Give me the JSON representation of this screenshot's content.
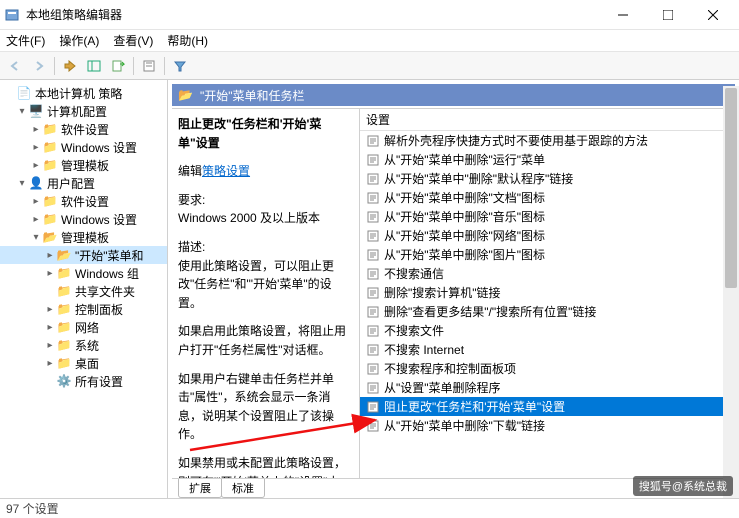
{
  "window": {
    "title": "本地组策略编辑器"
  },
  "menu": {
    "file": "文件(F)",
    "action": "操作(A)",
    "view": "查看(V)",
    "help": "帮助(H)"
  },
  "tree": {
    "root": "本地计算机 策略",
    "computer": "计算机配置",
    "c_soft": "软件设置",
    "c_win": "Windows 设置",
    "c_adm": "管理模板",
    "user": "用户配置",
    "u_soft": "软件设置",
    "u_win": "Windows 设置",
    "u_adm": "管理模板",
    "start": "\"开始\"菜单和",
    "wincomp": "Windows 组",
    "shared": "共享文件夹",
    "cpanel": "控制面板",
    "network": "网络",
    "system": "系统",
    "desktop": "桌面",
    "allset": "所有设置"
  },
  "category": {
    "header": "\"开始\"菜单和任务栏"
  },
  "detail": {
    "setting_title": "阻止更改\"任务栏和'开始'菜单\"设置",
    "edit_link": "策略设置",
    "req_label": "要求:",
    "req_text": "Windows 2000 及以上版本",
    "desc_label": "描述:",
    "desc1": "使用此策略设置，可以阻止更改\"任务栏\"和\"'开始'菜单\"的设置。",
    "desc2": "如果启用此策略设置，将阻止用户打开\"任务栏属性\"对话框。",
    "desc3": "如果用户右键单击任务栏并单击\"属性\"，系统会显示一条消息，说明某个设置阻止了该操作。",
    "desc4": "如果禁用或未配置此策略设置，则可在\"'开始'菜单上的\"设置\"中显示\"任务栏\"和\"'开始'菜单项。"
  },
  "list": {
    "header": "设置",
    "items": [
      "解析外壳程序快捷方式时不要使用基于跟踪的方法",
      "从\"开始\"菜单中删除\"运行\"菜单",
      "从\"开始\"菜单中\"删除\"默认程序\"链接",
      "从\"开始\"菜单中删除\"文档\"图标",
      "从\"开始\"菜单中删除\"音乐\"图标",
      "从\"开始\"菜单中删除\"网络\"图标",
      "从\"开始\"菜单中删除\"图片\"图标",
      "不搜索通信",
      "删除\"搜索计算机\"链接",
      "删除\"查看更多结果\"/\"搜索所有位置\"链接",
      "不搜索文件",
      "不搜索 Internet",
      "不搜索程序和控制面板项",
      "从\"设置\"菜单删除程序",
      "阻止更改\"任务栏和'开始'菜单\"设置",
      "从\"开始\"菜单中删除\"下载\"链接"
    ],
    "selected_index": 14
  },
  "tabs": {
    "extended": "扩展",
    "standard": "标准"
  },
  "status": {
    "count": "97 个设置"
  },
  "edit_prefix": "编辑",
  "watermark": "搜狐号@系统总裁"
}
